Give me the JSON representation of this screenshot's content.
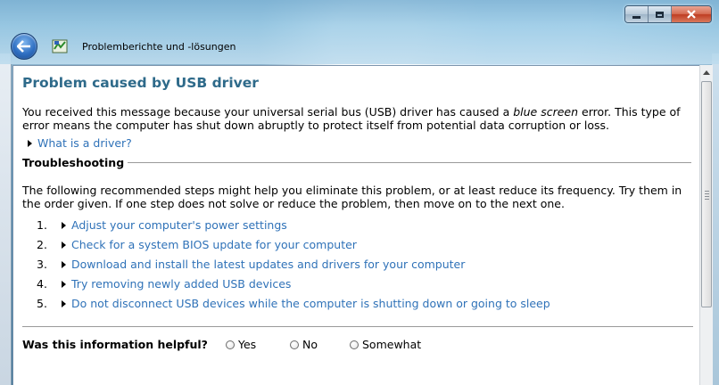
{
  "window": {
    "title": "Problemberichte und -lösungen",
    "controls": {
      "minimize": "minimize",
      "maximize": "maximize",
      "close": "close"
    }
  },
  "problem": {
    "heading": "Problem caused by USB driver",
    "intro_before": "You received this message because your universal serial bus (USB) driver has caused a ",
    "intro_emphasis": "blue screen",
    "intro_after": " error. This type of error means the computer has shut down abruptly to protect itself from potential data corruption or loss.",
    "what_is_driver": "What is a driver?"
  },
  "troubleshooting": {
    "heading": "Troubleshooting",
    "intro": "The following recommended steps might help you eliminate this problem, or at least reduce its frequency. Try them in the order given. If one step does not solve or reduce the problem, then move on to the next one.",
    "steps": [
      {
        "num": "1.",
        "label": "Adjust your computer's power settings"
      },
      {
        "num": "2.",
        "label": "Check for a system BIOS update for your computer"
      },
      {
        "num": "3.",
        "label": "Download and install the latest updates and drivers for your computer"
      },
      {
        "num": "4.",
        "label": "Try removing newly added USB devices"
      },
      {
        "num": "5.",
        "label": "Do not disconnect USB devices while the computer is shutting down or going to sleep"
      }
    ]
  },
  "feedback": {
    "question": "Was this information helpful?",
    "options": [
      "Yes",
      "No",
      "Somewhat"
    ]
  },
  "colors": {
    "heading": "#2e6a8a",
    "link": "#2f72b8",
    "close_button": "#c84a2e"
  },
  "icons": {
    "back": "back-arrow-icon",
    "app": "action-center-flag-icon",
    "expander": "triangle-right-icon"
  }
}
